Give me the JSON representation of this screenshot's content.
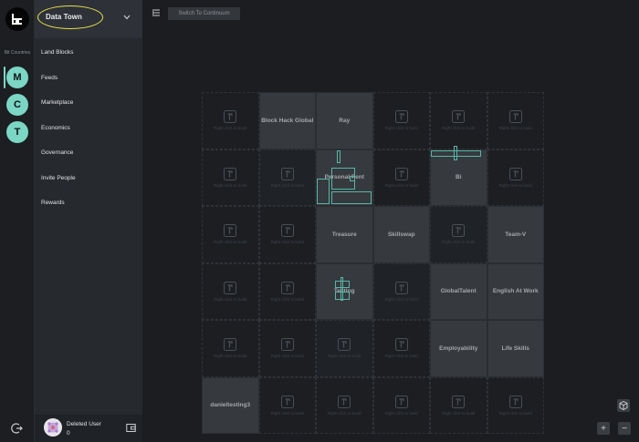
{
  "rail": {
    "label": "Bit Countries",
    "countries": [
      "M",
      "C",
      "T"
    ]
  },
  "sidebar": {
    "town": "Data Town",
    "items": [
      {
        "label": "Land Blocks"
      },
      {
        "label": "Feeds"
      },
      {
        "label": "Marketplace"
      },
      {
        "label": "Economics"
      },
      {
        "label": "Governance"
      },
      {
        "label": "Invite People"
      },
      {
        "label": "Rewards"
      }
    ],
    "user": {
      "name": "Deleted User",
      "count": "0"
    }
  },
  "toolbar": {
    "switch_label": "Switch To Continuum"
  },
  "map": {
    "empty_hint": "Right click to build",
    "blocks": {
      "r0c1": "Block Hack Global",
      "r0c2": "Ray",
      "r1c2": "Personal Pent",
      "r1c4": "Bi",
      "r2c2": "Treasure",
      "r2c3": "Skillswap",
      "r2c5": "Team-V",
      "r3c2": "Testing",
      "r3c4": "GlobalTalent",
      "r3c5": "English At Work",
      "r4c4": "Employability",
      "r4c5": "Life Skills",
      "r5c0": "danieltesting3"
    }
  },
  "zoom": {
    "plus": "+",
    "minus": "−"
  },
  "colors": {
    "accent": "#7bd6c4",
    "highlight_oval": "#e6e04b"
  }
}
